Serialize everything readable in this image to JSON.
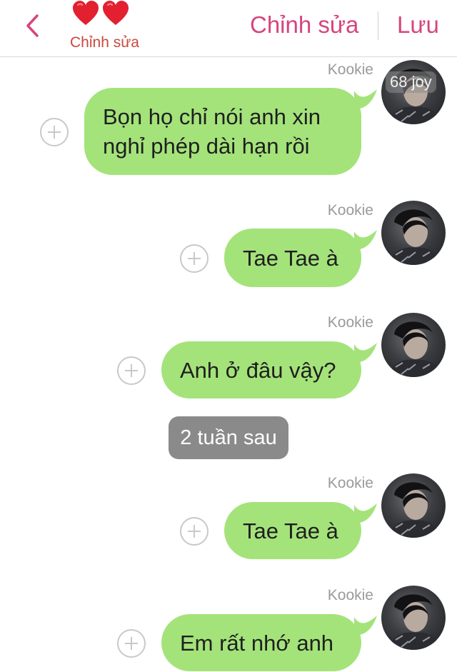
{
  "header": {
    "subtitle": "Chỉnh sửa",
    "edit_label": "Chỉnh sửa",
    "save_label": "Lưu",
    "accent_color": "#d6457d"
  },
  "watermark": "68 joy",
  "messages": [
    {
      "sender": "Kookie",
      "text_lines": [
        "Bọn họ chỉ nói anh xin",
        "nghỉ phép dài hạn rồi"
      ]
    },
    {
      "sender": "Kookie",
      "text": "Tae Tae à"
    },
    {
      "sender": "Kookie",
      "text": "Anh ở đâu vậy?"
    },
    {
      "sender": "Kookie",
      "text": "Tae Tae à"
    },
    {
      "sender": "Kookie",
      "text": "Em rất nhớ anh"
    }
  ],
  "time_separator": "2 tuần sau",
  "bubble_color": "#a4e37a"
}
